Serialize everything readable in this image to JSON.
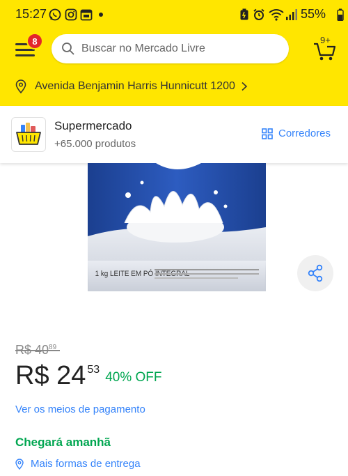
{
  "status_bar": {
    "time": "15:27",
    "battery": "55%",
    "notification_icons": [
      "whatsapp-icon",
      "instagram-icon",
      "calendar-icon"
    ],
    "system_icons": [
      "battery-saver-icon",
      "alarm-icon",
      "wifi-icon",
      "signal-icon"
    ]
  },
  "header": {
    "menu_badge": "8",
    "search_placeholder": "Buscar no Mercado Livre",
    "cart_count": "9+",
    "address": "Avenida Benjamin Harris Hunnicutt 1200"
  },
  "store": {
    "name": "Supermercado",
    "product_count": "+65.000 produtos",
    "aisles_label": "Corredores"
  },
  "product": {
    "image_label": "1 kg LEITE EM PÓ INTEGRAL",
    "old_price": "R$ 40",
    "old_price_cents": "89",
    "price": "R$ 24",
    "price_cents": "53",
    "discount": "40% OFF",
    "payment_link": "Ver os meios de pagamento",
    "arrival": "Chegará amanhã",
    "delivery_link": "Mais formas de entrega"
  },
  "colors": {
    "brand_yellow": "#FFE600",
    "link_blue": "#3483FA",
    "success_green": "#00A650",
    "badge_red": "#E3262B"
  }
}
